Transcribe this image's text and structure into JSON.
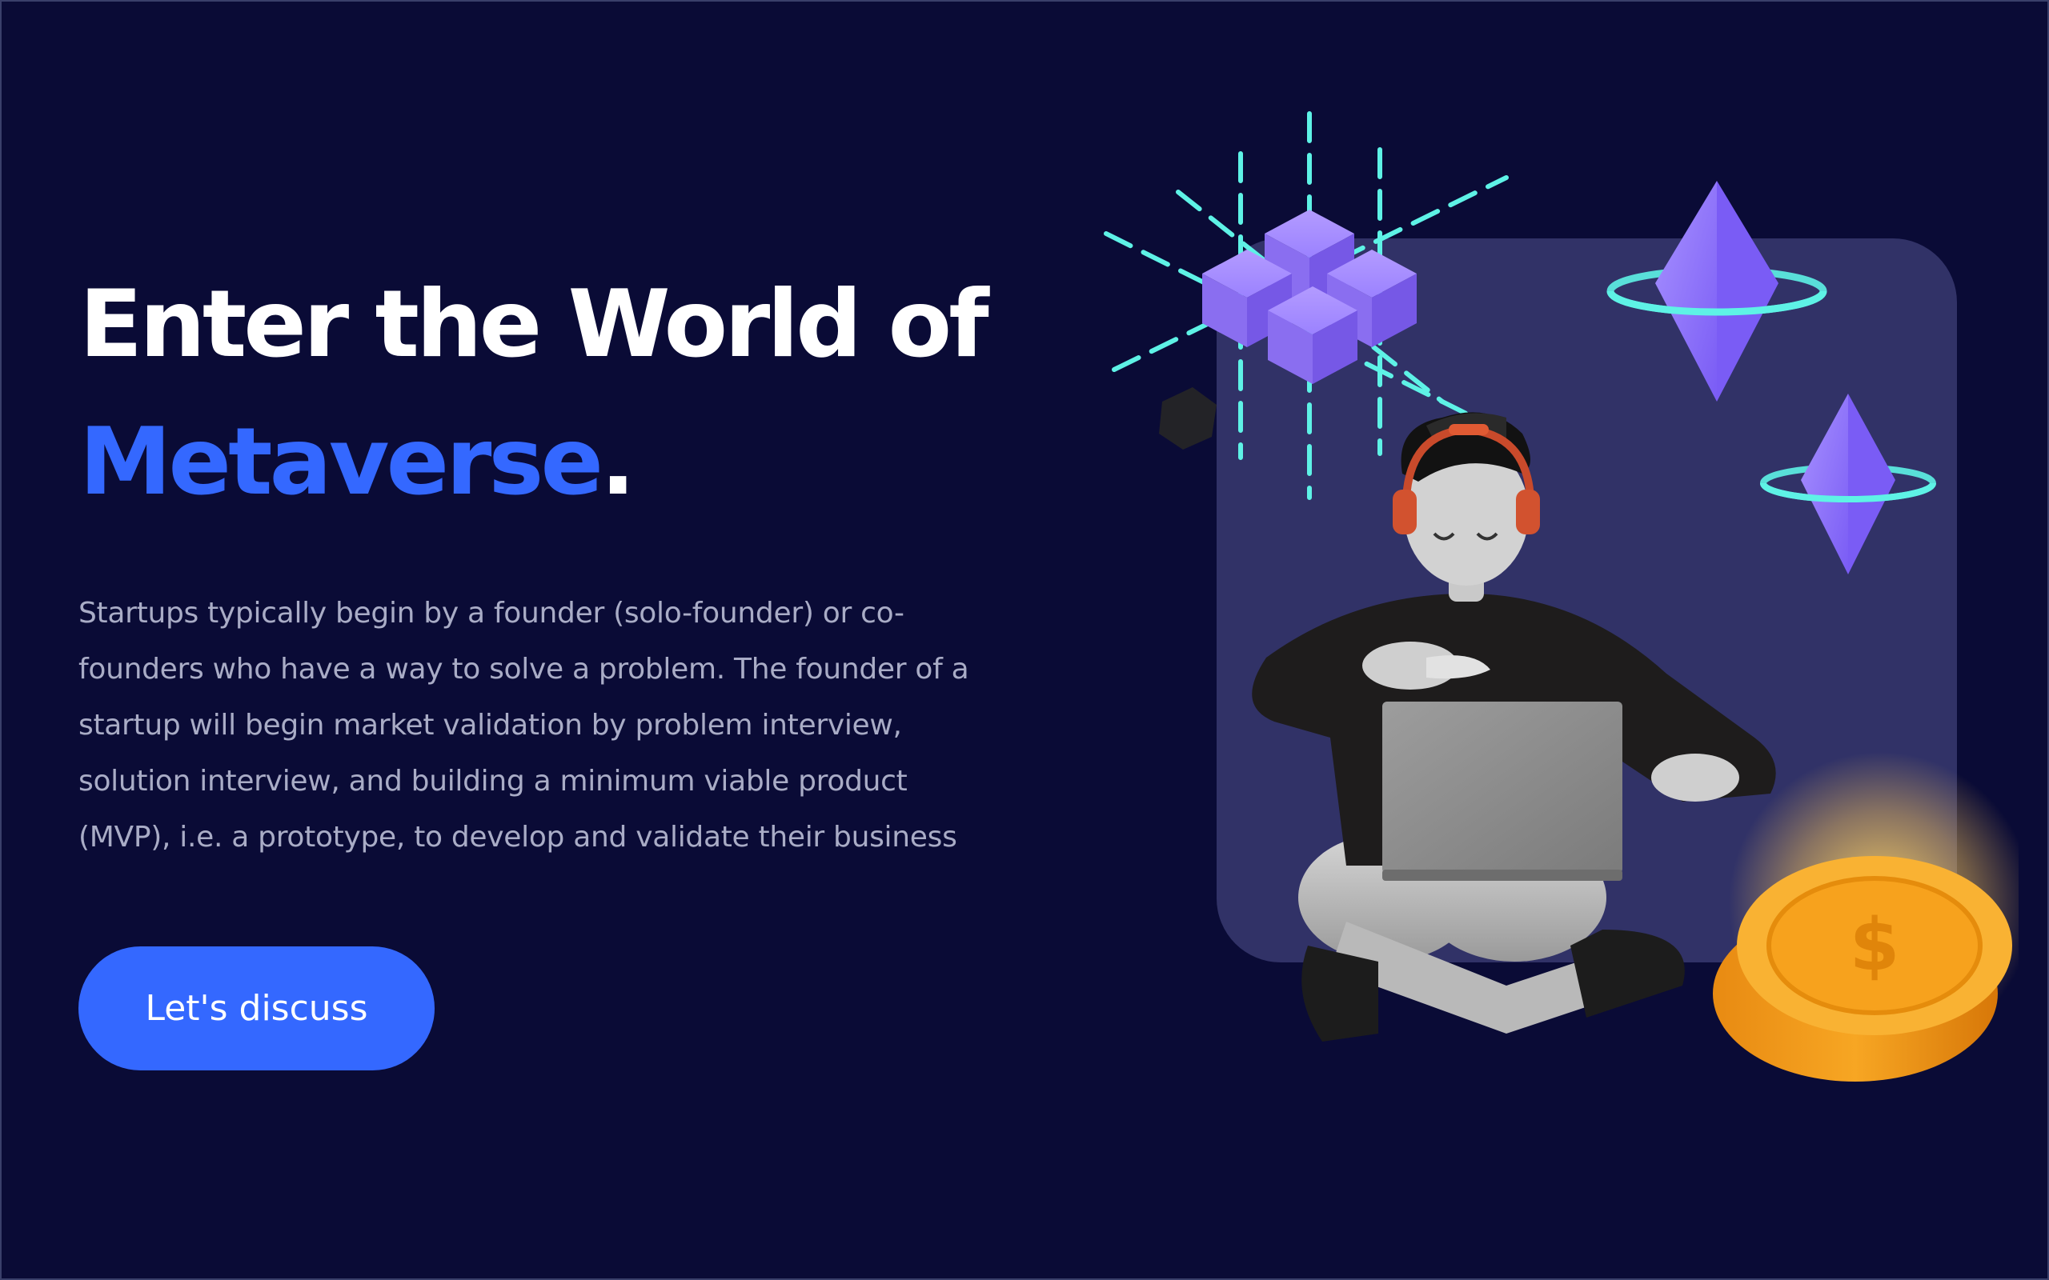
{
  "hero": {
    "title_line1": "Enter the World of",
    "title_accent": "Metaverse",
    "title_dot": ".",
    "description": "Startups typically begin by a founder (solo-founder) or co-founders who have a way to solve a problem. The founder of a startup will begin market validation by problem interview, solution interview, and building a minimum viable product (MVP), i.e. a prototype, to develop and validate their business",
    "cta_label": "Let's discuss"
  },
  "theme": {
    "background": "#0a0b36",
    "accent": "#3468ff",
    "text_primary": "#ffffff",
    "text_muted": "#a9acc6",
    "glass_panel": "#34356a",
    "crystal": "#8f73ff",
    "ring": "#5ef2e6",
    "coin": "#f5a623"
  },
  "illustration": {
    "subject": "3D character with headphones using a laptop",
    "icons": [
      "blockchain-cubes-icon",
      "ethereum-crystal-icon",
      "ethereum-crystal-icon",
      "gold-coin-icon",
      "laptop-icon"
    ]
  }
}
